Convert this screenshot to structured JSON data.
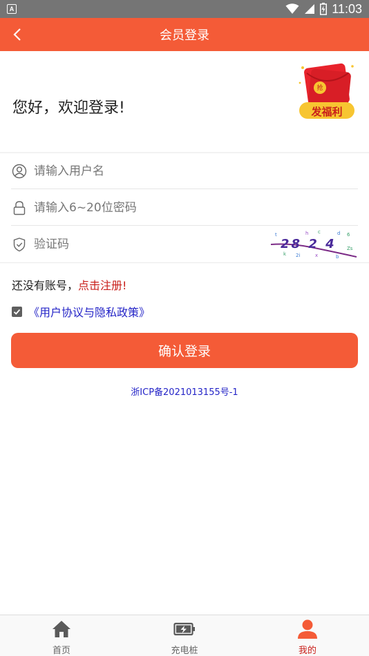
{
  "status_bar": {
    "time": "11:03",
    "notification_icon": "A"
  },
  "header": {
    "title": "会员登录",
    "back_icon": "chevron-left-icon"
  },
  "welcome": {
    "text": "您好，欢迎登录!"
  },
  "promo": {
    "badge_char": "抢",
    "label": "发福利"
  },
  "form": {
    "username": {
      "placeholder": "请输入用户名",
      "value": ""
    },
    "password": {
      "placeholder": "请输入6~20位密码",
      "value": ""
    },
    "captcha": {
      "placeholder": "验证码",
      "value": "",
      "image_text": "28 2 4"
    }
  },
  "register": {
    "prompt": "还没有账号，",
    "link": "点击注册!"
  },
  "agreement": {
    "checked": true,
    "link": "《用户协议与隐私政策》"
  },
  "login_button": {
    "label": "确认登录"
  },
  "icp": {
    "text": "浙ICP备2021013155号-1"
  },
  "tabbar": {
    "items": [
      {
        "label": "首页",
        "icon": "home-icon",
        "active": false
      },
      {
        "label": "充电桩",
        "icon": "battery-charging-icon",
        "active": false
      },
      {
        "label": "我的",
        "icon": "user-icon",
        "active": true
      }
    ]
  },
  "colors": {
    "accent": "#f45b37",
    "link_red": "#c9201b",
    "link_blue": "#2424c7"
  }
}
